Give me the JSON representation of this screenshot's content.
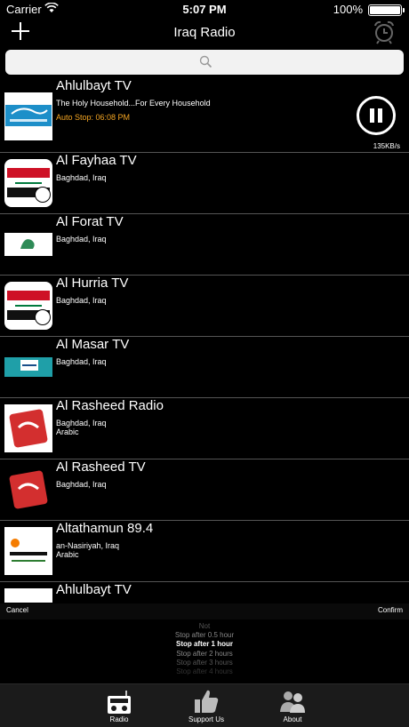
{
  "status": {
    "carrier": "Carrier",
    "time": "5:07 PM",
    "battery": "100%"
  },
  "nav": {
    "title": "Iraq Radio",
    "add_icon": "plus-icon",
    "alarm_icon": "alarm-clock-icon"
  },
  "search": {
    "placeholder": "",
    "icon": "search-icon"
  },
  "stations": [
    {
      "name": "Ahlulbayt TV",
      "sub1": "The Holy Household...For Every Household",
      "sub2": "Auto Stop: 06:08 PM",
      "speed": "135KB/s",
      "playing": true
    },
    {
      "name": "Al Fayhaa TV",
      "sub1": "Baghdad, Iraq",
      "sub2": ""
    },
    {
      "name": "Al Forat TV",
      "sub1": "Baghdad, Iraq",
      "sub2": ""
    },
    {
      "name": "Al Hurria TV",
      "sub1": "Baghdad, Iraq",
      "sub2": ""
    },
    {
      "name": "Al Masar TV",
      "sub1": "Baghdad, Iraq",
      "sub2": ""
    },
    {
      "name": "Al Rasheed Radio",
      "sub1": "Baghdad, Iraq",
      "sub2": "Arabic"
    },
    {
      "name": "Al Rasheed TV",
      "sub1": "Baghdad, Iraq",
      "sub2": ""
    },
    {
      "name": "Altathamun 89.4",
      "sub1": "an-Nasiriyah, Iraq",
      "sub2": "Arabic"
    },
    {
      "name": "Ahlulbayt TV",
      "sub1": "",
      "sub2": ""
    }
  ],
  "picker": {
    "cancel": "Cancel",
    "confirm": "Confirm",
    "options": [
      "Not",
      "Stop after 0.5 hour",
      "Stop after 1 hour",
      "Stop after 2 hours",
      "Stop after 3 hours",
      "Stop after 4 hours"
    ],
    "selected_index": 2
  },
  "tabs": [
    {
      "label": "Radio",
      "icon": "radio-icon"
    },
    {
      "label": "Support Us",
      "icon": "thumbs-up-icon"
    },
    {
      "label": "About",
      "icon": "people-icon"
    }
  ],
  "colors": {
    "accent": "#f5a623",
    "background": "#000000",
    "tabbar": "#1b1b1b"
  }
}
